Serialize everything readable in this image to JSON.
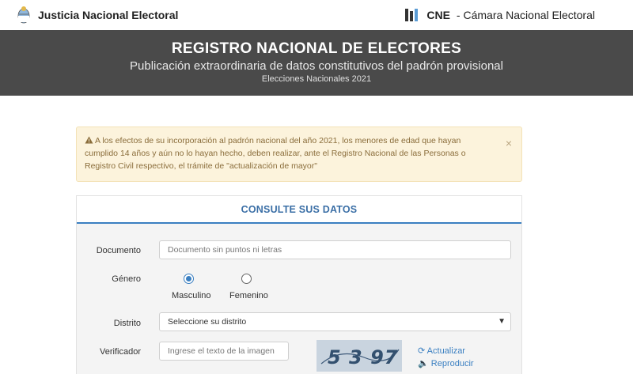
{
  "header": {
    "left_title": "Justicia Nacional Electoral",
    "right_abbrev": "CNE",
    "right_title": "- Cámara Nacional Electoral"
  },
  "hero": {
    "title": "REGISTRO NACIONAL DE ELECTORES",
    "subtitle": "Publicación extraordinaria de datos constitutivos del padrón provisional",
    "caption": "Elecciones Nacionales 2021"
  },
  "alert": {
    "text": "A los efectos de su incorporación al padrón nacional del año 2021, los menores de edad que hayan cumplido 14 años y aún no lo hayan hecho, deben realizar, ante el Registro Nacional de las Personas o Registro Civil respectivo, el trámite de \"actualización de mayor\"",
    "close": "×"
  },
  "form": {
    "heading": "CONSULTE SUS DATOS",
    "documento_label": "Documento",
    "documento_placeholder": "Documento sin puntos ni letras",
    "genero_label": "Género",
    "masculino": "Masculino",
    "femenino": "Femenino",
    "distrito_label": "Distrito",
    "distrito_value": "Seleccione su distrito",
    "verificador_label": "Verificador",
    "verificador_placeholder": "Ingrese el texto de la imagen",
    "captcha_text": "5 3 97",
    "actualizar": "Actualizar",
    "reproducir": "Reproducir"
  },
  "colors": {
    "hero_bg": "#4a4a4a",
    "accent": "#3a7fc1",
    "alert_bg": "#fcf3dc"
  }
}
